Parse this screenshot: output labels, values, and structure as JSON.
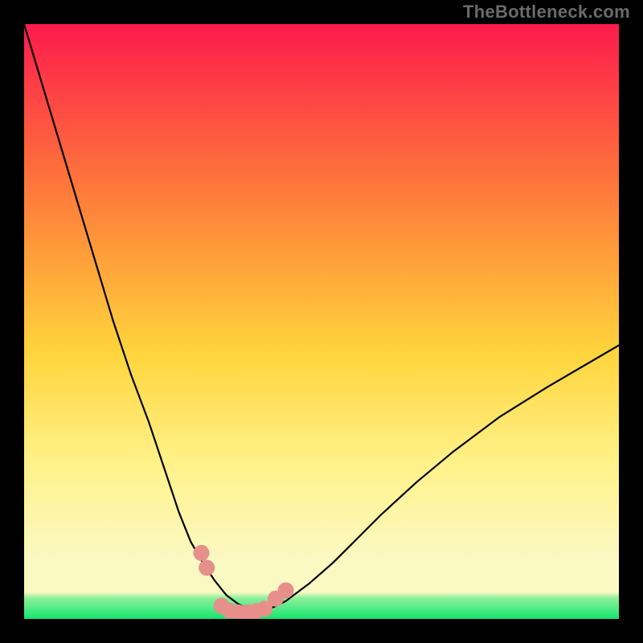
{
  "watermark": "TheBottleneck.com",
  "colors": {
    "page_bg": "#000000",
    "grad_top": "#fc1b4c",
    "grad_mid_upper": "#ff7a3a",
    "grad_mid": "#ffd43b",
    "grad_lower": "#fff28a",
    "grad_band_light": "#fbf9c2",
    "grad_green_light": "#8cf09a",
    "grad_green": "#17e56f",
    "curve": "#000000",
    "marker_fill": "#e78f8b"
  },
  "chart_data": {
    "type": "line",
    "title": "",
    "xlabel": "",
    "ylabel": "",
    "x": [
      0.0,
      0.03,
      0.06,
      0.09,
      0.12,
      0.15,
      0.18,
      0.21,
      0.24,
      0.26,
      0.28,
      0.3,
      0.32,
      0.34,
      0.36,
      0.38,
      0.4,
      0.42,
      0.44,
      0.48,
      0.52,
      0.56,
      0.6,
      0.66,
      0.72,
      0.8,
      0.88,
      0.94,
      1.0
    ],
    "y": [
      1.0,
      0.9,
      0.8,
      0.7,
      0.6,
      0.5,
      0.41,
      0.33,
      0.24,
      0.18,
      0.13,
      0.095,
      0.065,
      0.04,
      0.025,
      0.015,
      0.015,
      0.02,
      0.03,
      0.06,
      0.095,
      0.135,
      0.175,
      0.23,
      0.28,
      0.34,
      0.39,
      0.425,
      0.46
    ],
    "xlim": [
      0,
      1
    ],
    "ylim": [
      0,
      1
    ],
    "markers": [
      {
        "x": 0.298,
        "y": 0.111
      },
      {
        "x": 0.307,
        "y": 0.086
      },
      {
        "x": 0.332,
        "y": 0.022
      },
      {
        "x": 0.345,
        "y": 0.014
      },
      {
        "x": 0.36,
        "y": 0.011
      },
      {
        "x": 0.375,
        "y": 0.011
      },
      {
        "x": 0.39,
        "y": 0.013
      },
      {
        "x": 0.404,
        "y": 0.017
      },
      {
        "x": 0.423,
        "y": 0.034
      },
      {
        "x": 0.44,
        "y": 0.048
      }
    ],
    "marker_radius_norm": 0.0135,
    "green_band_y_norm": [
      0.015,
      0.04
    ]
  }
}
